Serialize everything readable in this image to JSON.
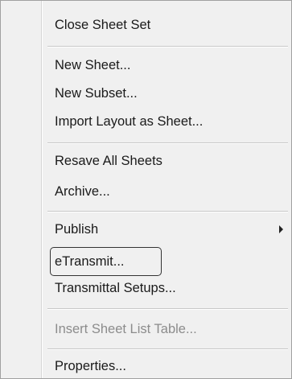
{
  "menu": {
    "items": {
      "close_sheet_set": "Close Sheet Set",
      "new_sheet": "New Sheet...",
      "new_subset": "New Subset...",
      "import_layout": "Import Layout as Sheet...",
      "resave_all": "Resave All Sheets",
      "archive": "Archive...",
      "publish": "Publish",
      "etransmit": "eTransmit...",
      "transmittal_setups": "Transmittal Setups...",
      "insert_sheet_list": "Insert Sheet List Table...",
      "properties": "Properties..."
    },
    "submenu_icon": "chevron-right-icon",
    "highlighted_item": "eTransmit..."
  }
}
